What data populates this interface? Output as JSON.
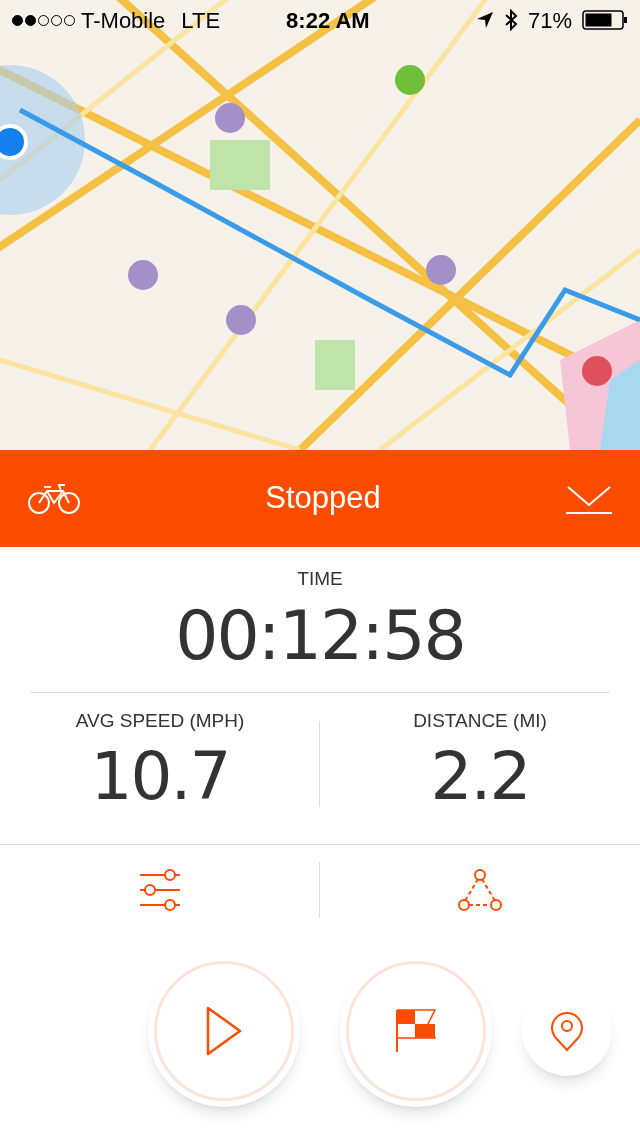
{
  "status_bar": {
    "carrier": "T-Mobile",
    "network": "LTE",
    "time": "8:22 AM",
    "battery": "71%"
  },
  "header": {
    "title": "Stopped"
  },
  "time": {
    "label": "TIME",
    "value": "00:12:58"
  },
  "stats": [
    {
      "label": "AVG SPEED (MPH)",
      "value": "10.7"
    },
    {
      "label": "DISTANCE (MI)",
      "value": "2.2"
    }
  ]
}
